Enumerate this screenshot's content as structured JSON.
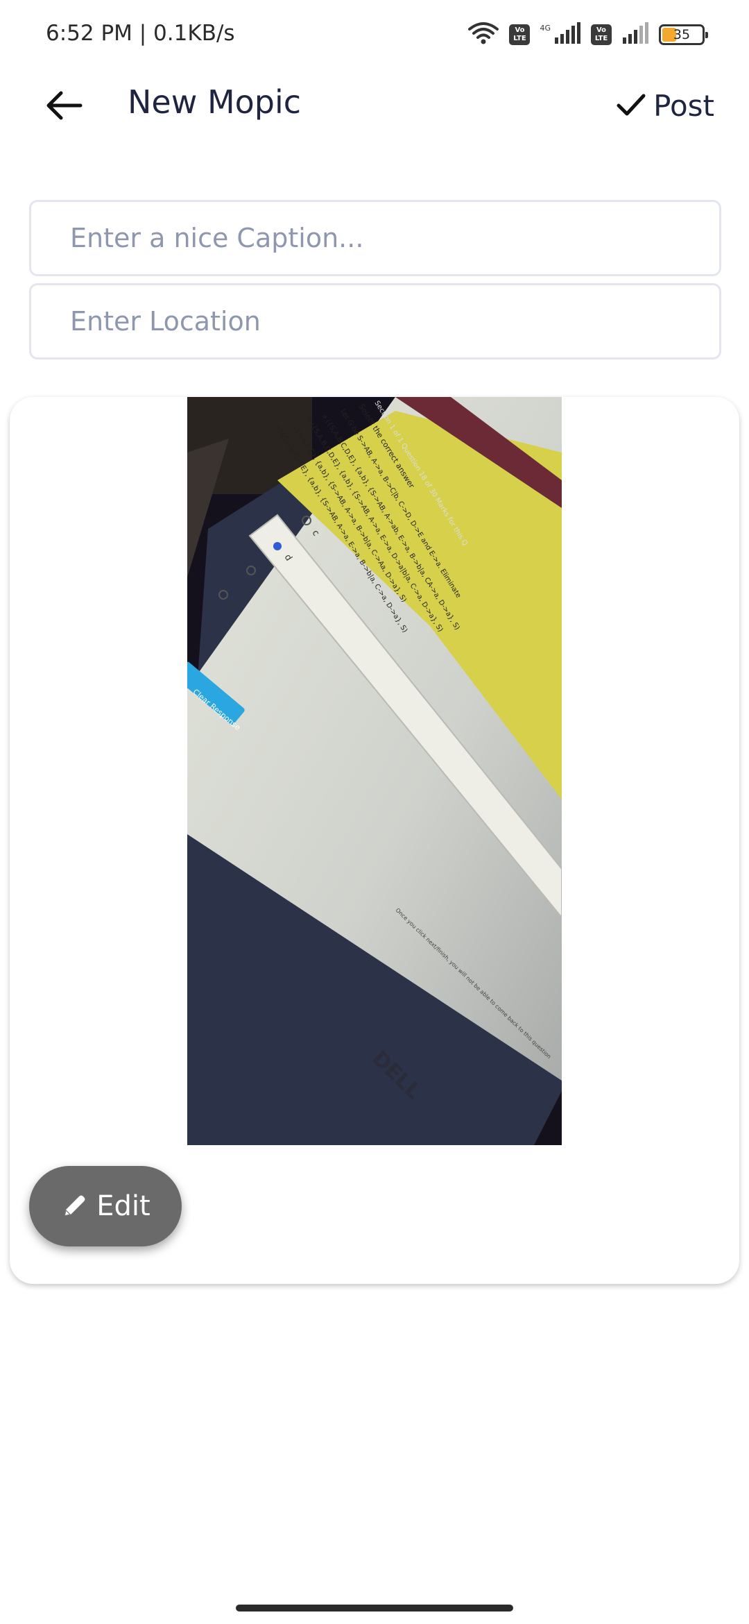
{
  "status_bar": {
    "time": "6:52 PM | 0.1KB/s",
    "network_label": "4G",
    "volte_label": "Vo LTE",
    "battery": "35",
    "battery_level_percent": 35,
    "icons": [
      "wifi-icon",
      "volte-icon",
      "signal-icon",
      "volte-icon",
      "signal-icon",
      "battery-icon"
    ]
  },
  "app_bar": {
    "title": "New Mopic",
    "back_icon": "arrow-left-icon",
    "post_label": "Post",
    "post_icon": "check-icon"
  },
  "form": {
    "caption_placeholder": "Enter a nice Caption...",
    "location_placeholder": "Enter Location"
  },
  "photo": {
    "question_lines": [
      "Section 1 of 1   Question 18 of 30   Marks for this Q",
      "Select the correct answer",
      "Let G be S->AB, A->a, B->C|b, C->D, D->E and E->a. Eliminate",
      "a   ({S,A,B,C,D,E}, {a,b}, {S->AB, A->ab, E->a, B->b|a, CA->a, D->a}, S)",
      "b   ({S,A,B,C,D,E}, {a,b}, {S->AB, A->a, E->a, D->a|b|a, C->a, D->a}, S)",
      "c   ({S,A,B,E}, {a,b}, {S->AB, A->a, B->b|a, C->Aa, D->a}, S)",
      "d   ({S,A,B,C,D,E}, {a,b}, {S->AB, A->a, E->a, B->b|a, C->a, D->a}, S)"
    ],
    "options": [
      "c",
      "d",
      "b",
      "a"
    ],
    "clear_response": "Clear Response",
    "footer_note": "Once you click next/finish, you will not be able to come back to this question",
    "brand": "DELL"
  },
  "edit_button": {
    "label": "Edit",
    "icon": "pencil-icon"
  },
  "colors": {
    "text_primary": "#1f2540",
    "placeholder": "#8e97ad",
    "field_border": "#e3e6ee",
    "edit_button_bg": "#6a6a6a",
    "battery_fill": "#f2a92e",
    "screen_yellow": "#d9d34a",
    "clear_response_blue": "#2aa7e0"
  }
}
